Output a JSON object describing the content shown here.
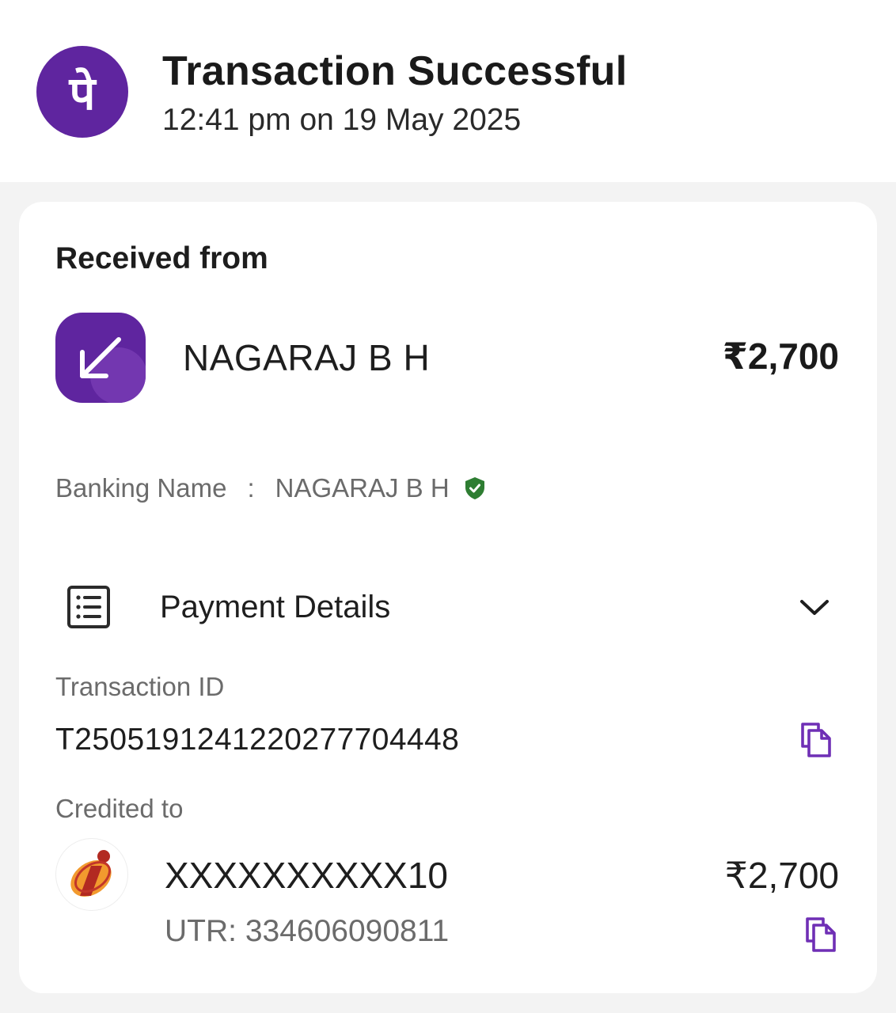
{
  "header": {
    "title": "Transaction Successful",
    "datetime": "12:41 pm on 19 May 2025",
    "logo_glyph": "पे",
    "brand_color": "#5f259f"
  },
  "received": {
    "section_label": "Received from",
    "sender_name": "NAGARAJ B H",
    "amount": "₹2,700",
    "icon": "arrow-down-left-icon"
  },
  "banking": {
    "label": "Banking Name",
    "separator": ":",
    "name": "NAGARAJ B H",
    "verified_icon": "verified-shield-icon",
    "verified_color": "#2e7d32"
  },
  "payment_details": {
    "label": "Payment Details",
    "icon": "receipt-list-icon",
    "expand_icon": "chevron-down-icon"
  },
  "transaction": {
    "id_label": "Transaction ID",
    "id_value": "T2505191241220277704448",
    "copy_icon": "copy-icon"
  },
  "credited": {
    "label": "Credited to",
    "bank_logo": "bank-logo-icon",
    "account": "XXXXXXXXXX10",
    "amount": "₹2,700",
    "utr": "UTR: 334606090811",
    "copy_icon": "copy-icon"
  }
}
